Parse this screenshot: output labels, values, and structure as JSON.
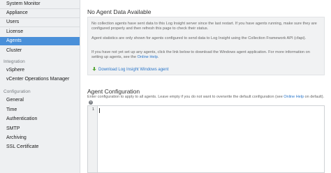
{
  "sidebar": {
    "items_top": [
      {
        "label": "System Monitor",
        "active": false
      },
      {
        "label": "Appliance",
        "active": false
      },
      {
        "label": "Users",
        "active": false
      },
      {
        "label": "License",
        "active": false
      },
      {
        "label": "Agents",
        "active": true
      },
      {
        "label": "Cluster",
        "active": false
      }
    ],
    "integration_title": "Integration",
    "integration_items": [
      "vSphere",
      "vCenter Operations Manager"
    ],
    "configuration_title": "Configuration",
    "configuration_items": [
      "General",
      "Time",
      "Authentication",
      "SMTP",
      "Archiving",
      "SSL Certificate"
    ]
  },
  "main": {
    "title": "No Agent Data Available",
    "para1": "No collection agents have sent data to this Log Insight server since the last restart. If you have agents running, make sure they are configured properly and then refresh this page to check their status.",
    "para2": "Agent statistics are only shown for agents configured to send data to Log Insight using the Collection Framework API (cfapi).",
    "para3_before": "If you have not yet set up any agents, click the link below to download the Windows agent application. For more information on setting up agents, see the ",
    "para3_link": "Online Help",
    "para3_after": ".",
    "download_link": "Download Log Insight Windows agent",
    "config_title": "Agent Configuration",
    "config_desc_before": "Enter configuration to apply to all agents. Leave empty if you do not want to overwrite the default configuration (see ",
    "config_desc_link": "Online Help",
    "config_desc_after": " on default).",
    "help_icon_glyph": "?",
    "editor_line_number": "1"
  },
  "colors": {
    "active_nav": "#4a90d9",
    "link": "#2a76c9",
    "download_icon": "#5aa83c"
  }
}
